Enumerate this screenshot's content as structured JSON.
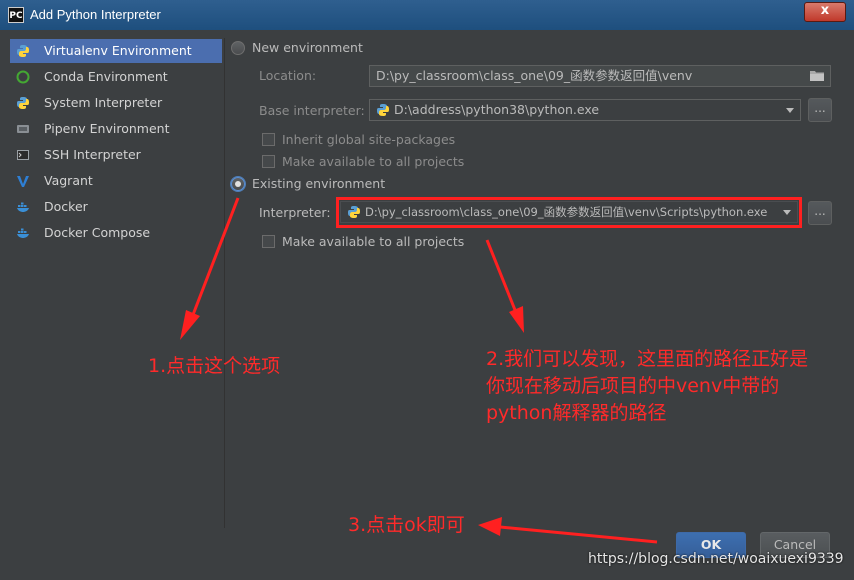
{
  "window": {
    "title": "Add Python Interpreter",
    "app_icon_text": "PC",
    "close_label": "x"
  },
  "sidebar": {
    "items": [
      {
        "label": "Virtualenv Environment",
        "icon": "virtualenv-icon",
        "selected": true
      },
      {
        "label": "Conda Environment",
        "icon": "conda-icon"
      },
      {
        "label": "System Interpreter",
        "icon": "python-icon"
      },
      {
        "label": "Pipenv Environment",
        "icon": "pipenv-icon"
      },
      {
        "label": "SSH Interpreter",
        "icon": "ssh-icon"
      },
      {
        "label": "Vagrant",
        "icon": "vagrant-icon"
      },
      {
        "label": "Docker",
        "icon": "docker-icon"
      },
      {
        "label": "Docker Compose",
        "icon": "docker-compose-icon"
      }
    ]
  },
  "new_env": {
    "radio_label": "New environment",
    "selected": false,
    "location_label": "Location:",
    "location_value": "D:\\py_classroom\\class_one\\09_函数参数返回值\\venv",
    "base_label": "Base interpreter:",
    "base_value": "D:\\address\\python38\\python.exe",
    "inherit_label": "Inherit global site-packages",
    "available_label": "Make available to all projects",
    "browse_label": "..."
  },
  "existing_env": {
    "radio_label": "Existing environment",
    "selected": true,
    "interpreter_label": "Interpreter:",
    "interpreter_value": "D:\\py_classroom\\class_one\\09_函数参数返回值\\venv\\Scripts\\python.exe",
    "available_label": "Make available to all projects",
    "browse_label": "..."
  },
  "annotations": {
    "a1": "1.点击这个选项",
    "a2_line1": "2.我们可以发现，这里面的路径正好是",
    "a2_line2": "你现在移动后项目的中venv中带的",
    "a2_line3": "python解释器的路径",
    "a3": "3.点击ok即可",
    "color": "#ff2a2a"
  },
  "buttons": {
    "ok": "OK",
    "cancel": "Cancel"
  },
  "watermark": "https://blog.csdn.net/woaixuexi9339",
  "colors": {
    "background": "#3c3f41",
    "selection": "#4b6eaf",
    "title_bar": "#2f5f8f"
  }
}
